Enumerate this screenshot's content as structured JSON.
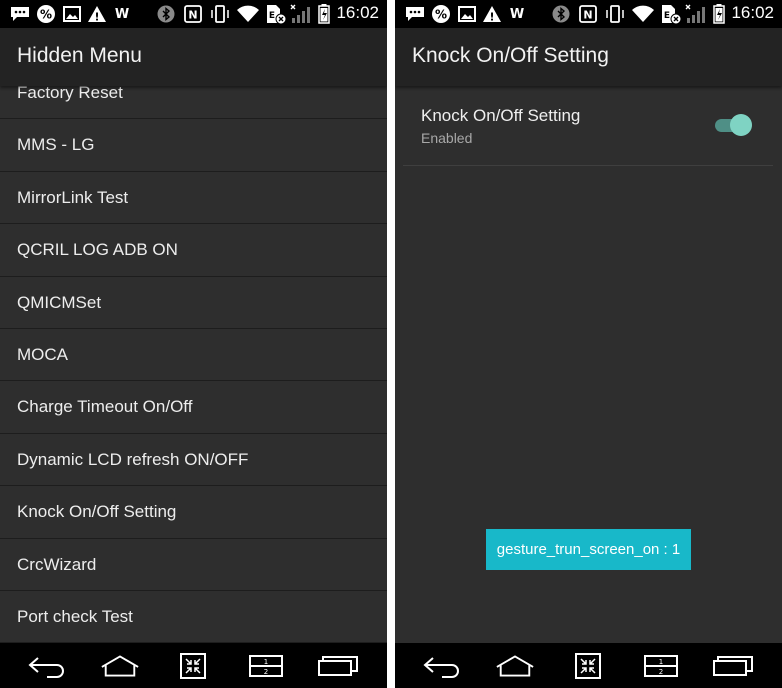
{
  "status_bar": {
    "time": "16:02",
    "left_icons": [
      "message-icon",
      "percent-icon",
      "image-icon",
      "warning-icon",
      "w-icon"
    ],
    "right_icons": [
      "bluetooth-icon",
      "nfc-icon",
      "vibrate-icon",
      "wifi-icon",
      "sim-icon",
      "signal-icon",
      "battery-icon"
    ],
    "w_glyph": "W",
    "percent_glyph": "%",
    "warning_glyph": "!",
    "nfc_glyph": "N",
    "sim_glyph": "E"
  },
  "left_screen": {
    "title": "Hidden Menu",
    "items": [
      "Factory Reset",
      "MMS - LG",
      "MirrorLink Test",
      "QCRIL LOG ADB ON",
      "QMICMSet",
      "MOCA",
      "Charge Timeout On/Off",
      "Dynamic LCD refresh ON/OFF",
      "Knock On/Off Setting",
      "CrcWizard",
      "Port check Test"
    ]
  },
  "right_screen": {
    "title": "Knock On/Off Setting",
    "setting": {
      "title": "Knock On/Off Setting",
      "subtitle": "Enabled",
      "toggle_on": true
    },
    "toast": "gesture_trun_screen_on : 1"
  },
  "nav_bar": {
    "buttons": [
      "back",
      "home",
      "qslide",
      "dual-window",
      "recent-apps"
    ],
    "dual_window_labels": [
      "1",
      "2"
    ]
  },
  "colors": {
    "status_bar": "#000000",
    "action_bar": "#232323",
    "background": "#2e2e2e",
    "toggle_accent": "#7fd3c3",
    "toast": "#18b8c9"
  }
}
